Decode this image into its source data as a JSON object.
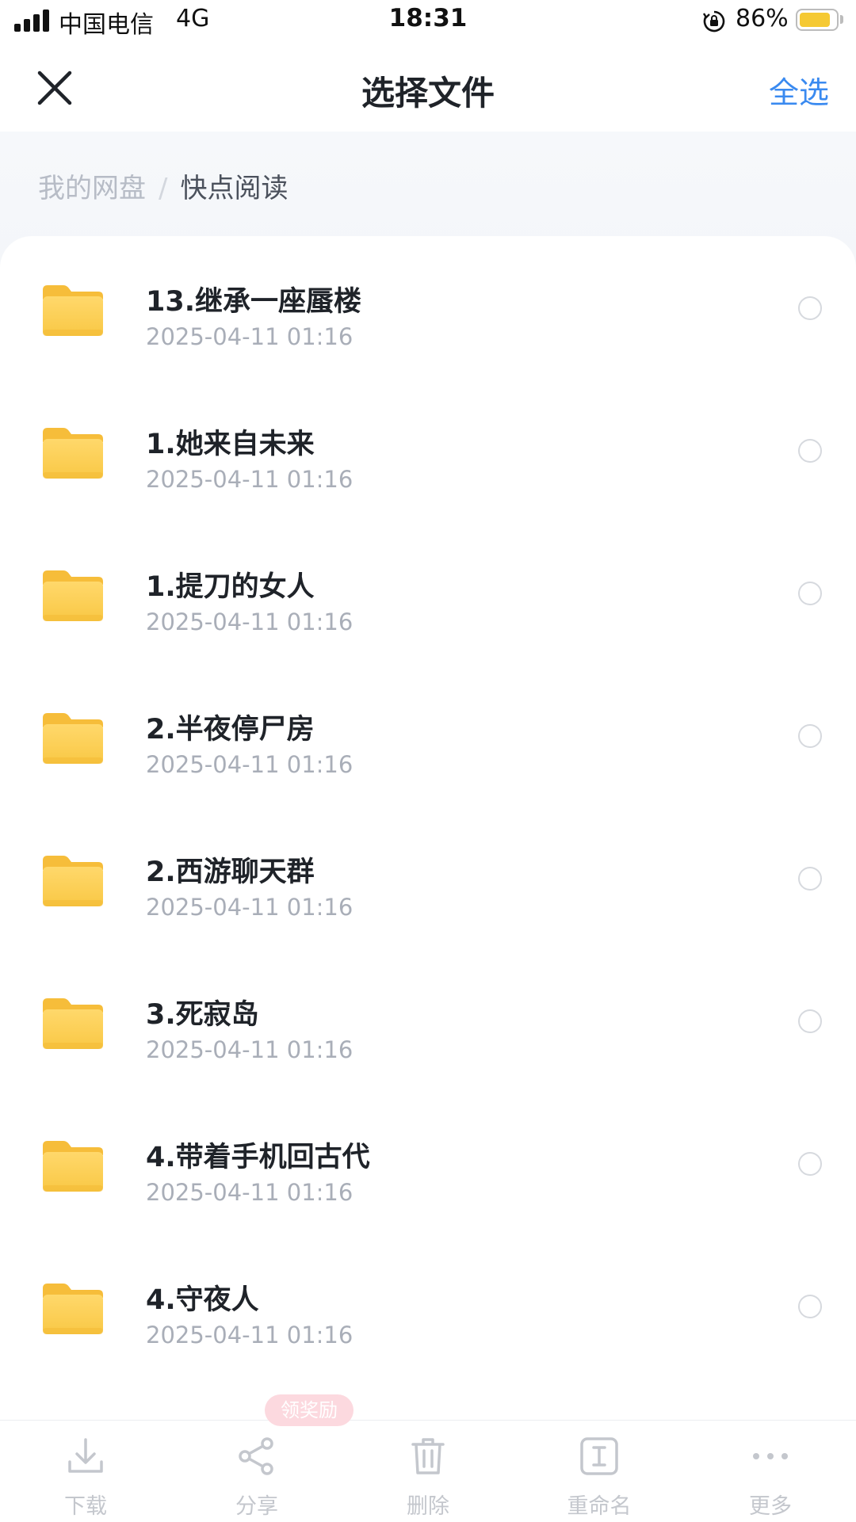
{
  "status_bar": {
    "carrier": "中国电信",
    "network": "4G",
    "time": "18:31",
    "battery_percent": "86%",
    "battery_level": 0.86,
    "battery_color": "#f5c933"
  },
  "header": {
    "title": "选择文件",
    "select_all_label": "全选",
    "close_icon": "close-icon",
    "accent_color": "#3a8af0"
  },
  "breadcrumb": {
    "root": "我的网盘",
    "separator": "/",
    "current": "快点阅读"
  },
  "files": [
    {
      "name": "13.继承一座蜃楼",
      "date": "2025-04-11 01:16",
      "icon": "folder-icon"
    },
    {
      "name": "1.她来自未来",
      "date": "2025-04-11 01:16",
      "icon": "folder-icon"
    },
    {
      "name": "1.提刀的女人",
      "date": "2025-04-11 01:16",
      "icon": "folder-icon"
    },
    {
      "name": "2.半夜停尸房",
      "date": "2025-04-11 01:16",
      "icon": "folder-icon"
    },
    {
      "name": "2.西游聊天群",
      "date": "2025-04-11 01:16",
      "icon": "folder-icon"
    },
    {
      "name": "3.死寂岛",
      "date": "2025-04-11 01:16",
      "icon": "folder-icon"
    },
    {
      "name": "4.带着手机回古代",
      "date": "2025-04-11 01:16",
      "icon": "folder-icon"
    },
    {
      "name": "4.守夜人",
      "date": "2025-04-11 01:16",
      "icon": "folder-icon"
    }
  ],
  "toolbar": {
    "download_label": "下载",
    "share_label": "分享",
    "delete_label": "删除",
    "rename_label": "重命名",
    "more_label": "更多",
    "reward_badge": "领奖励"
  }
}
